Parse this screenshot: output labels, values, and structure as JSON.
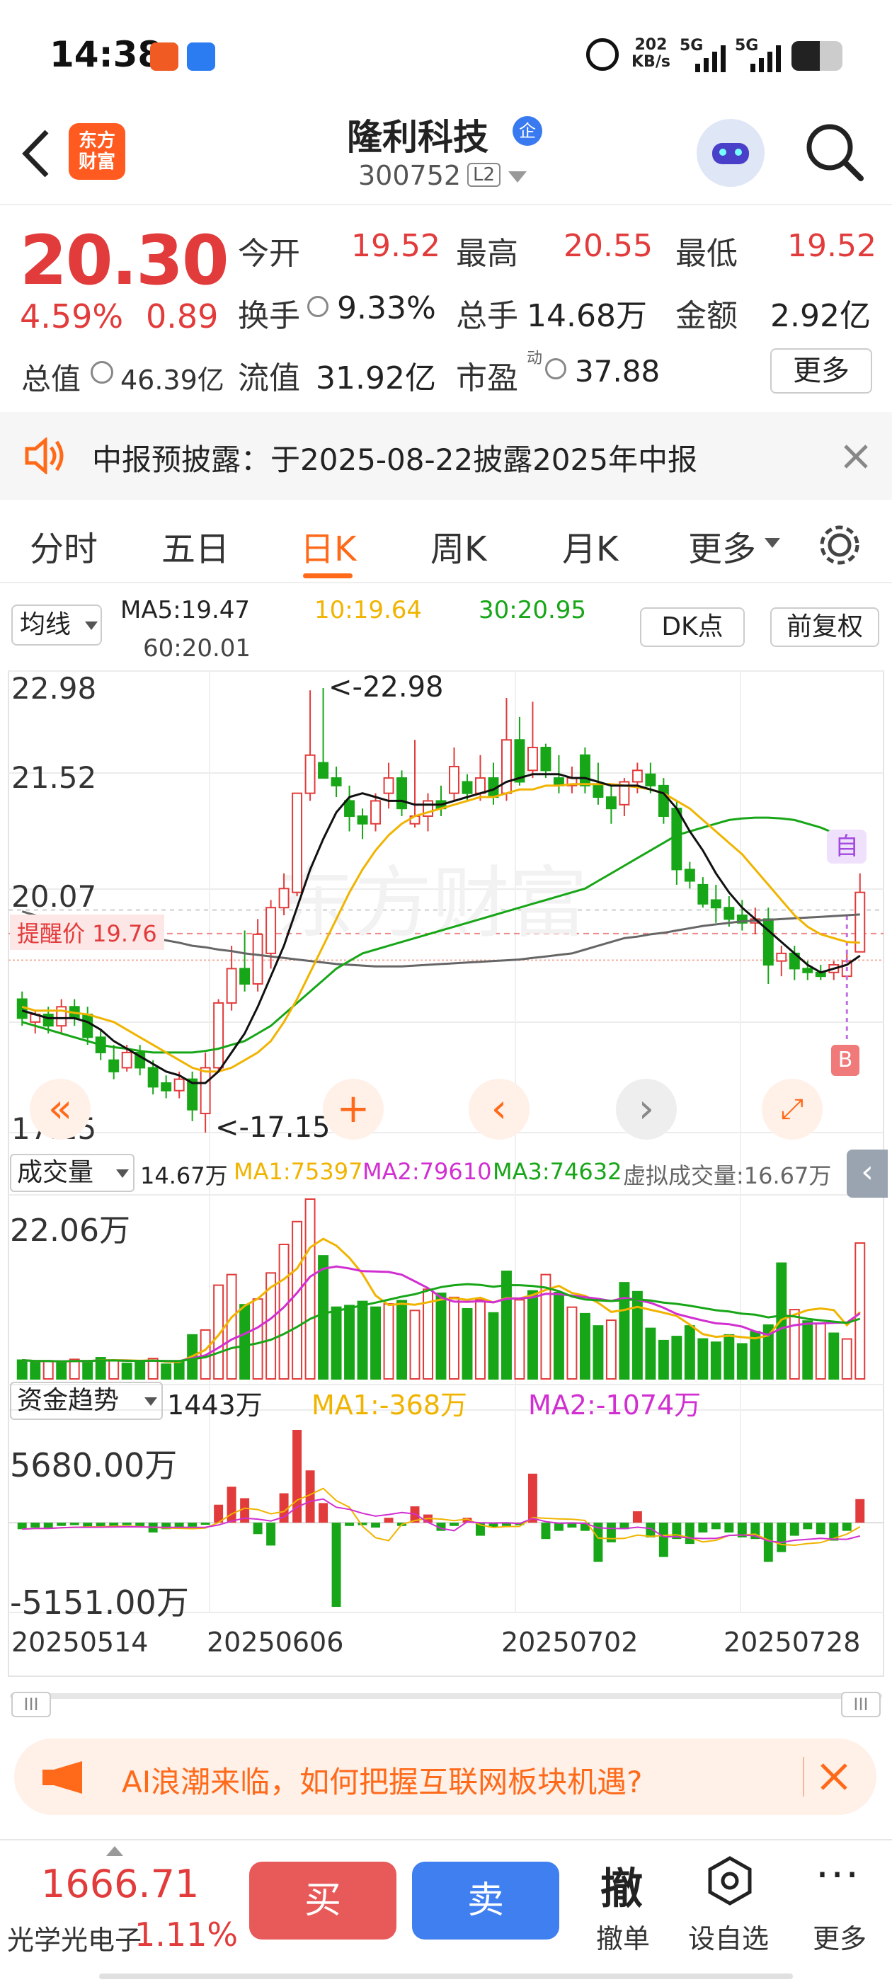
{
  "status_bar": {
    "time": "14:38",
    "net_speed_value": "202",
    "net_speed_unit": "KB/s",
    "sig1": "5G",
    "sig2": "5G"
  },
  "header": {
    "app_logo_line1": "东方",
    "app_logo_line2": "财富",
    "stock_name": "隆利科技",
    "stock_code": "300752",
    "level_badge": "L2",
    "enterprise_badge": "企"
  },
  "quote": {
    "price": "20.30",
    "change_pct": "4.59%",
    "change_abs": "0.89",
    "open_label": "今开",
    "open": "19.52",
    "high_label": "最高",
    "high": "20.55",
    "low_label": "最低",
    "low": "19.52",
    "turnover_label": "换手",
    "turnover": "9.33%",
    "volume_label": "总手",
    "volume": "14.68万",
    "amount_label": "金额",
    "amount": "2.92亿",
    "mktcap_label": "总值",
    "mktcap": "46.39亿",
    "float_label": "流值",
    "float_cap": "31.92亿",
    "pe_label": "市盈",
    "pe_sup": "动",
    "pe": "37.88",
    "more_button": "更多"
  },
  "notice": {
    "text": "中报预披露：于2025-08-22披露2025年中报"
  },
  "tabs": [
    {
      "label": "分时",
      "active": false
    },
    {
      "label": "五日",
      "active": false
    },
    {
      "label": "日K",
      "active": true
    },
    {
      "label": "周K",
      "active": false
    },
    {
      "label": "月K",
      "active": false
    },
    {
      "label": "更多",
      "active": false
    }
  ],
  "ma_legend": {
    "selector": "均线",
    "ma5": "MA5:19.47",
    "ma10": "10:19.64",
    "ma30": "30:20.95",
    "ma60": "60:20.01",
    "dk_button": "DK点",
    "adjust_button": "前复权"
  },
  "kline": {
    "price_max": "22.98",
    "price_mid1": "21.52",
    "price_mid2": "20.07",
    "price_min": "17.15",
    "reminder_label": "提醒价 19.76",
    "high_marker": "<-22.98",
    "low_marker": "<-17.15",
    "self_marker": "自",
    "buy_marker": "B",
    "watermark": "东方财富"
  },
  "volume_panel": {
    "selector": "成交量",
    "vol": "14.67万",
    "ma1": "MA1:75397",
    "ma2": "MA2:79610",
    "ma3": "MA3:74632",
    "virtual": "虚拟成交量:16.67万",
    "axis_max": "22.06万"
  },
  "fund_panel": {
    "selector": "资金趋势",
    "value": "1443万",
    "ma1": "MA1:-368万",
    "ma2": "MA2:-1074万",
    "axis_max": "5680.00万",
    "axis_min": "-5151.00万"
  },
  "dates": [
    "20250514",
    "20250606",
    "20250702",
    "20250728"
  ],
  "ad_banner": {
    "text": "AI浪潮来临，如何把握互联网板块机遇?"
  },
  "bottom_bar": {
    "index_value": "1666.71",
    "index_name": "光学光电子",
    "index_change": "1.11%",
    "buy": "买",
    "sell": "卖",
    "cancel_icon_text": "撤",
    "cancel_label": "撤单",
    "watch_label": "设自选",
    "more_label": "更多"
  },
  "colors": {
    "up": "#e23b3b",
    "down": "#17a617",
    "ma5": "#111111",
    "ma10": "#f0b400",
    "ma30": "#17a617",
    "ma60": "#666666",
    "ma2_vol": "#d12fd1",
    "accent": "#ff6a1a",
    "buy_btn": "#e85a5a",
    "sell_btn": "#3f7ff0"
  },
  "chart_data": {
    "type": "candlestick",
    "y_range": [
      17.15,
      22.98
    ],
    "candles": [
      {
        "o": 18.9,
        "h": 19.0,
        "l": 18.55,
        "c": 18.65
      },
      {
        "o": 18.6,
        "h": 18.75,
        "l": 18.45,
        "c": 18.7
      },
      {
        "o": 18.7,
        "h": 18.8,
        "l": 18.45,
        "c": 18.55
      },
      {
        "o": 18.55,
        "h": 18.9,
        "l": 18.45,
        "c": 18.8
      },
      {
        "o": 18.8,
        "h": 18.9,
        "l": 18.55,
        "c": 18.65
      },
      {
        "o": 18.7,
        "h": 18.8,
        "l": 18.3,
        "c": 18.4
      },
      {
        "o": 18.4,
        "h": 18.5,
        "l": 18.1,
        "c": 18.2
      },
      {
        "o": 18.1,
        "h": 18.3,
        "l": 17.85,
        "c": 17.95
      },
      {
        "o": 18.0,
        "h": 18.3,
        "l": 17.95,
        "c": 18.2
      },
      {
        "o": 18.2,
        "h": 18.3,
        "l": 17.9,
        "c": 18.0
      },
      {
        "o": 18.0,
        "h": 18.1,
        "l": 17.65,
        "c": 17.75
      },
      {
        "o": 17.8,
        "h": 17.9,
        "l": 17.6,
        "c": 17.7
      },
      {
        "o": 17.7,
        "h": 17.95,
        "l": 17.6,
        "c": 17.85
      },
      {
        "o": 17.85,
        "h": 17.95,
        "l": 17.3,
        "c": 17.45
      },
      {
        "o": 17.4,
        "h": 18.2,
        "l": 17.15,
        "c": 18.0
      },
      {
        "o": 18.0,
        "h": 18.9,
        "l": 17.95,
        "c": 18.85
      },
      {
        "o": 18.85,
        "h": 19.6,
        "l": 18.75,
        "c": 19.3
      },
      {
        "o": 19.3,
        "h": 19.8,
        "l": 19.0,
        "c": 19.1
      },
      {
        "o": 19.1,
        "h": 19.95,
        "l": 19.0,
        "c": 19.75
      },
      {
        "o": 19.5,
        "h": 20.2,
        "l": 19.3,
        "c": 20.1
      },
      {
        "o": 20.1,
        "h": 20.55,
        "l": 20.0,
        "c": 20.35
      },
      {
        "o": 20.3,
        "h": 21.6,
        "l": 20.25,
        "c": 21.6
      },
      {
        "o": 21.6,
        "h": 22.95,
        "l": 21.5,
        "c": 22.1
      },
      {
        "o": 22.0,
        "h": 22.98,
        "l": 21.9,
        "c": 21.8
      },
      {
        "o": 21.8,
        "h": 21.95,
        "l": 21.55,
        "c": 21.7
      },
      {
        "o": 21.5,
        "h": 21.7,
        "l": 21.1,
        "c": 21.3
      },
      {
        "o": 21.3,
        "h": 21.4,
        "l": 21.0,
        "c": 21.2
      },
      {
        "o": 21.2,
        "h": 21.6,
        "l": 21.1,
        "c": 21.5
      },
      {
        "o": 21.6,
        "h": 22.0,
        "l": 21.4,
        "c": 21.8
      },
      {
        "o": 21.8,
        "h": 21.9,
        "l": 21.3,
        "c": 21.4
      },
      {
        "o": 21.2,
        "h": 22.3,
        "l": 21.15,
        "c": 21.3
      },
      {
        "o": 21.3,
        "h": 21.6,
        "l": 21.1,
        "c": 21.5
      },
      {
        "o": 21.5,
        "h": 21.7,
        "l": 21.3,
        "c": 21.4
      },
      {
        "o": 21.6,
        "h": 22.2,
        "l": 21.5,
        "c": 21.95
      },
      {
        "o": 21.75,
        "h": 21.85,
        "l": 21.5,
        "c": 21.6
      },
      {
        "o": 21.6,
        "h": 22.1,
        "l": 21.5,
        "c": 21.8
      },
      {
        "o": 21.8,
        "h": 22.0,
        "l": 21.45,
        "c": 21.55
      },
      {
        "o": 21.6,
        "h": 22.85,
        "l": 21.5,
        "c": 22.3
      },
      {
        "o": 22.3,
        "h": 22.6,
        "l": 21.7,
        "c": 21.75
      },
      {
        "o": 21.9,
        "h": 22.8,
        "l": 21.8,
        "c": 22.2
      },
      {
        "o": 22.2,
        "h": 22.25,
        "l": 21.8,
        "c": 21.9
      },
      {
        "o": 21.8,
        "h": 22.1,
        "l": 21.6,
        "c": 21.7
      },
      {
        "o": 21.7,
        "h": 21.95,
        "l": 21.6,
        "c": 21.8
      },
      {
        "o": 22.1,
        "h": 22.2,
        "l": 21.6,
        "c": 21.7
      },
      {
        "o": 21.7,
        "h": 22.0,
        "l": 21.45,
        "c": 21.55
      },
      {
        "o": 21.55,
        "h": 21.7,
        "l": 21.2,
        "c": 21.4
      },
      {
        "o": 21.45,
        "h": 21.8,
        "l": 21.3,
        "c": 21.75
      },
      {
        "o": 21.75,
        "h": 22.0,
        "l": 21.6,
        "c": 21.9
      },
      {
        "o": 21.85,
        "h": 22.0,
        "l": 21.6,
        "c": 21.7
      },
      {
        "o": 21.7,
        "h": 21.8,
        "l": 21.2,
        "c": 21.3
      },
      {
        "o": 21.4,
        "h": 21.5,
        "l": 20.4,
        "c": 20.6
      },
      {
        "o": 20.6,
        "h": 20.7,
        "l": 20.35,
        "c": 20.45
      },
      {
        "o": 20.4,
        "h": 20.5,
        "l": 20.1,
        "c": 20.15
      },
      {
        "o": 20.2,
        "h": 20.4,
        "l": 19.9,
        "c": 20.1
      },
      {
        "o": 20.1,
        "h": 20.25,
        "l": 19.85,
        "c": 19.95
      },
      {
        "o": 20.0,
        "h": 20.2,
        "l": 19.8,
        "c": 19.9
      },
      {
        "o": 19.9,
        "h": 20.1,
        "l": 19.75,
        "c": 19.95
      },
      {
        "o": 19.95,
        "h": 20.1,
        "l": 19.1,
        "c": 19.35
      },
      {
        "o": 19.4,
        "h": 19.6,
        "l": 19.2,
        "c": 19.5
      },
      {
        "o": 19.5,
        "h": 19.6,
        "l": 19.15,
        "c": 19.3
      },
      {
        "o": 19.3,
        "h": 19.4,
        "l": 19.15,
        "c": 19.25
      },
      {
        "o": 19.25,
        "h": 19.35,
        "l": 19.15,
        "c": 19.2
      },
      {
        "o": 19.25,
        "h": 19.4,
        "l": 19.15,
        "c": 19.35
      },
      {
        "o": 19.2,
        "h": 19.55,
        "l": 19.15,
        "c": 19.4
      },
      {
        "o": 19.52,
        "h": 20.55,
        "l": 19.52,
        "c": 20.3
      }
    ],
    "ma5": [
      18.75,
      18.7,
      18.65,
      18.65,
      18.65,
      18.6,
      18.5,
      18.35,
      18.25,
      18.15,
      18.05,
      17.95,
      17.9,
      17.8,
      17.8,
      17.95,
      18.2,
      18.45,
      18.8,
      19.2,
      19.6,
      20.1,
      20.6,
      21.0,
      21.35,
      21.55,
      21.6,
      21.55,
      21.5,
      21.5,
      21.45,
      21.45,
      21.45,
      21.5,
      21.55,
      21.6,
      21.65,
      21.75,
      21.8,
      21.85,
      21.85,
      21.85,
      21.8,
      21.8,
      21.75,
      21.7,
      21.7,
      21.7,
      21.65,
      21.6,
      21.4,
      21.1,
      20.85,
      20.55,
      20.3,
      20.1,
      19.95,
      19.8,
      19.65,
      19.5,
      19.35,
      19.25,
      19.3,
      19.35,
      19.47
    ],
    "ma10": [
      18.8,
      18.75,
      18.75,
      18.75,
      18.72,
      18.7,
      18.65,
      18.6,
      18.5,
      18.4,
      18.3,
      18.2,
      18.1,
      18.0,
      17.95,
      17.95,
      18.0,
      18.1,
      18.2,
      18.35,
      18.6,
      18.9,
      19.25,
      19.6,
      19.95,
      20.3,
      20.6,
      20.85,
      21.05,
      21.2,
      21.3,
      21.35,
      21.4,
      21.45,
      21.5,
      21.55,
      21.55,
      21.6,
      21.65,
      21.65,
      21.7,
      21.7,
      21.72,
      21.72,
      21.72,
      21.72,
      21.7,
      21.68,
      21.65,
      21.6,
      21.5,
      21.4,
      21.25,
      21.1,
      20.95,
      20.8,
      20.6,
      20.4,
      20.2,
      20.0,
      19.85,
      19.75,
      19.7,
      19.65,
      19.64
    ],
    "ma30": [
      18.6,
      18.55,
      18.5,
      18.45,
      18.4,
      18.35,
      18.3,
      18.27,
      18.25,
      18.22,
      18.2,
      18.2,
      18.2,
      18.2,
      18.22,
      18.25,
      18.3,
      18.35,
      18.45,
      18.55,
      18.7,
      18.85,
      19.0,
      19.15,
      19.3,
      19.4,
      19.5,
      19.55,
      19.6,
      19.65,
      19.7,
      19.75,
      19.8,
      19.85,
      19.9,
      19.95,
      20.0,
      20.05,
      20.1,
      20.15,
      20.2,
      20.25,
      20.3,
      20.35,
      20.45,
      20.55,
      20.65,
      20.75,
      20.85,
      20.95,
      21.05,
      21.1,
      21.15,
      21.2,
      21.25,
      21.27,
      21.28,
      21.28,
      21.27,
      21.25,
      21.2,
      21.15,
      21.08,
      21.0,
      20.95
    ],
    "ma60": [
      20.05,
      20.0,
      19.95,
      19.9,
      19.87,
      19.83,
      19.8,
      19.77,
      19.74,
      19.72,
      19.7,
      19.67,
      19.64,
      19.6,
      19.58,
      19.55,
      19.53,
      19.5,
      19.48,
      19.46,
      19.44,
      19.42,
      19.4,
      19.38,
      19.36,
      19.35,
      19.34,
      19.33,
      19.33,
      19.33,
      19.34,
      19.35,
      19.36,
      19.37,
      19.38,
      19.39,
      19.4,
      19.41,
      19.42,
      19.44,
      19.46,
      19.48,
      19.5,
      19.55,
      19.6,
      19.65,
      19.7,
      19.72,
      19.75,
      19.77,
      19.8,
      19.83,
      19.86,
      19.88,
      19.9,
      19.92,
      19.93,
      19.94,
      19.95,
      19.96,
      19.97,
      19.98,
      19.99,
      20.0,
      20.01
    ],
    "volume_wan": [
      2.3,
      2.1,
      2.2,
      2.0,
      2.4,
      2.2,
      2.6,
      2.3,
      1.9,
      2.1,
      2.5,
      1.8,
      2.1,
      5.4,
      6.0,
      11.5,
      12.8,
      9.1,
      9.8,
      13.0,
      16.5,
      19.3,
      22.06,
      15.1,
      8.8,
      9.0,
      9.5,
      8.8,
      9.2,
      9.6,
      8.4,
      11.0,
      10.5,
      10.0,
      8.6,
      9.7,
      8.1,
      13.2,
      9.7,
      10.8,
      12.8,
      10.6,
      8.8,
      8.0,
      6.5,
      7.2,
      11.8,
      10.7,
      6.2,
      4.7,
      5.2,
      6.5,
      4.9,
      4.5,
      5.4,
      4.3,
      5.8,
      6.6,
      14.2,
      8.5,
      7.1,
      6.8,
      5.6,
      4.9,
      16.67
    ],
    "volume_up": [
      false,
      false,
      true,
      false,
      true,
      false,
      false,
      true,
      false,
      false,
      true,
      false,
      false,
      false,
      true,
      true,
      true,
      false,
      true,
      true,
      true,
      true,
      true,
      false,
      false,
      false,
      false,
      false,
      true,
      false,
      true,
      true,
      false,
      true,
      false,
      true,
      false,
      false,
      true,
      false,
      true,
      false,
      true,
      false,
      false,
      true,
      false,
      false,
      false,
      false,
      false,
      false,
      false,
      false,
      false,
      false,
      false,
      false,
      false,
      true,
      false,
      true,
      false,
      true,
      true
    ],
    "fund_trend_wan": [
      -400,
      -300,
      -350,
      -200,
      -150,
      -300,
      -250,
      -200,
      -150,
      -280,
      -600,
      -400,
      -300,
      -250,
      -100,
      1100,
      2200,
      1500,
      -700,
      -1400,
      1800,
      5680,
      3200,
      1200,
      -5151,
      -200,
      -150,
      -300,
      300,
      -200,
      1000,
      500,
      -500,
      -200,
      300,
      -800,
      -300,
      -200,
      -150,
      3000,
      -1000,
      -500,
      -300,
      -500,
      -2400,
      -1200,
      -400,
      700,
      -900,
      -2100,
      -1000,
      -1300,
      -600,
      -400,
      -600,
      -900,
      -1000,
      -2400,
      -1800,
      -800,
      -400,
      -700,
      -1100,
      -500,
      1443
    ]
  }
}
